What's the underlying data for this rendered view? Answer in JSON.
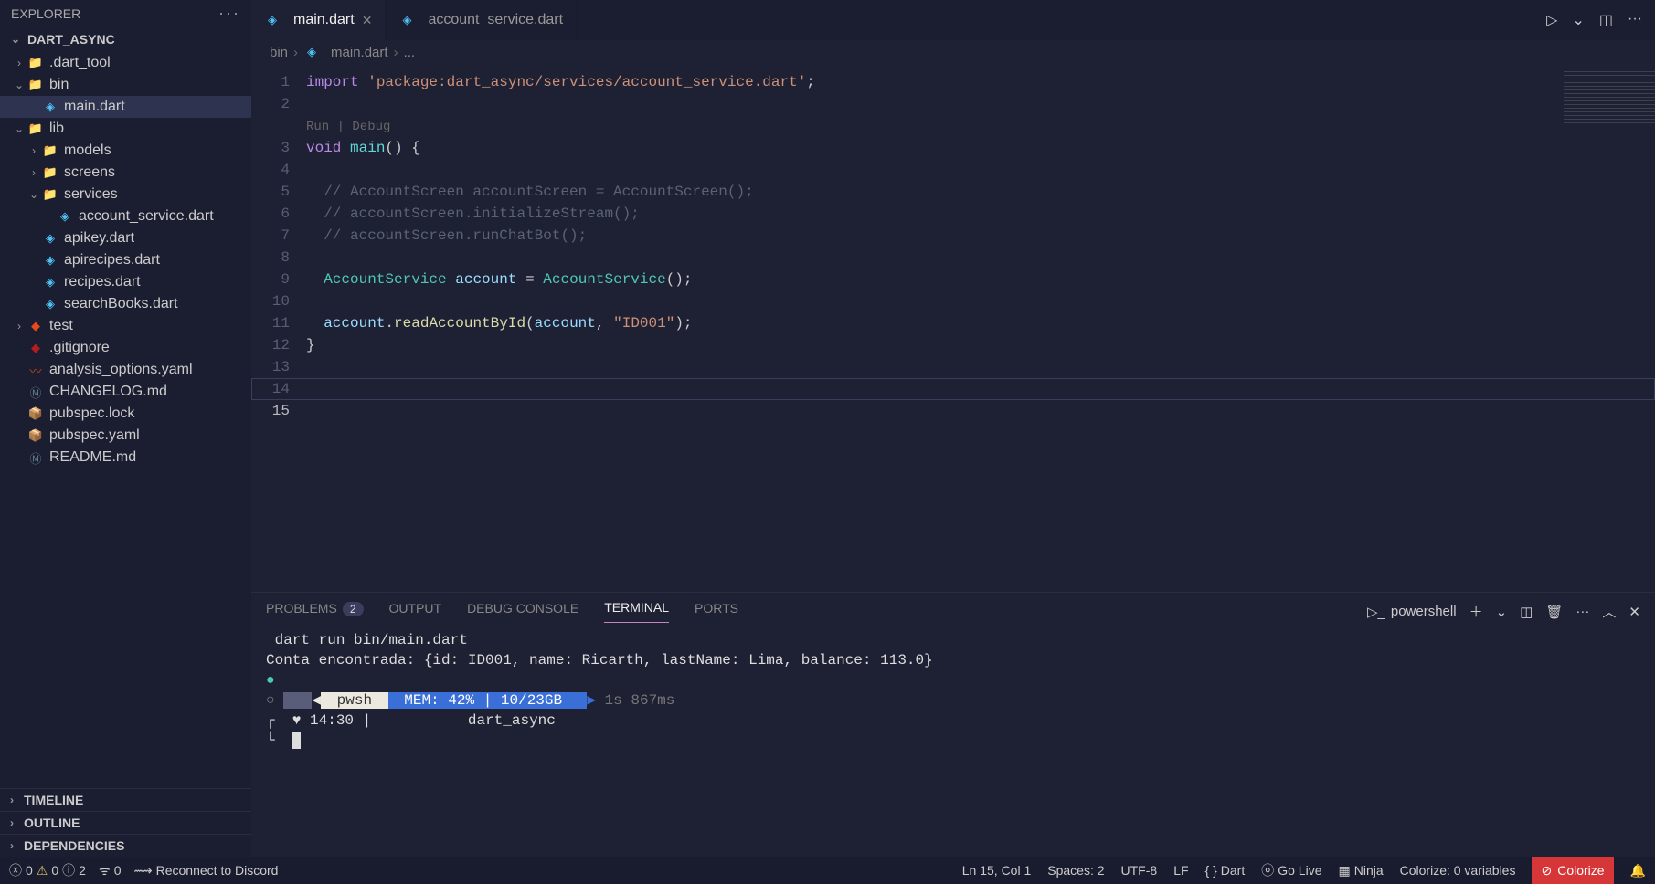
{
  "sidebar": {
    "title": "EXPLORER",
    "project": "DART_ASYNC",
    "tree": [
      {
        "lvl": 1,
        "chev": "›",
        "icon": "folder",
        "name": ".dart_tool"
      },
      {
        "lvl": 1,
        "chev": "⌄",
        "icon": "folder",
        "name": "bin"
      },
      {
        "lvl": 2,
        "chev": "",
        "icon": "dart",
        "name": "main.dart",
        "active": true
      },
      {
        "lvl": 1,
        "chev": "⌄",
        "icon": "folder",
        "name": "lib"
      },
      {
        "lvl": 2,
        "chev": "›",
        "icon": "folder",
        "name": "models"
      },
      {
        "lvl": 2,
        "chev": "›",
        "icon": "folder",
        "name": "screens"
      },
      {
        "lvl": 2,
        "chev": "⌄",
        "icon": "folder",
        "name": "services"
      },
      {
        "lvl": 3,
        "chev": "",
        "icon": "dart",
        "name": "account_service.dart"
      },
      {
        "lvl": 2,
        "chev": "",
        "icon": "dart",
        "name": "apikey.dart"
      },
      {
        "lvl": 2,
        "chev": "",
        "icon": "dart",
        "name": "apirecipes.dart"
      },
      {
        "lvl": 2,
        "chev": "",
        "icon": "dart",
        "name": "recipes.dart"
      },
      {
        "lvl": 2,
        "chev": "",
        "icon": "dart",
        "name": "searchBooks.dart"
      },
      {
        "lvl": 1,
        "chev": "›",
        "icon": "git",
        "name": "test"
      },
      {
        "lvl": 1,
        "chev": "",
        "icon": "ignore",
        "name": ".gitignore"
      },
      {
        "lvl": 1,
        "chev": "",
        "icon": "yaml",
        "name": "analysis_options.yaml"
      },
      {
        "lvl": 1,
        "chev": "",
        "icon": "md",
        "name": "CHANGELOG.md"
      },
      {
        "lvl": 1,
        "chev": "",
        "icon": "pub",
        "name": "pubspec.lock"
      },
      {
        "lvl": 1,
        "chev": "",
        "icon": "pub",
        "name": "pubspec.yaml"
      },
      {
        "lvl": 1,
        "chev": "",
        "icon": "md",
        "name": "README.md"
      }
    ],
    "panels": [
      "TIMELINE",
      "OUTLINE",
      "DEPENDENCIES"
    ]
  },
  "tabs": [
    {
      "name": "main.dart",
      "icon": "dart",
      "active": true,
      "closable": true
    },
    {
      "name": "account_service.dart",
      "icon": "dart",
      "active": false,
      "closable": false
    }
  ],
  "breadcrumb": [
    "bin",
    "main.dart",
    "..."
  ],
  "codelens": "Run | Debug",
  "code_lines": 15,
  "current_line": 15,
  "panel": {
    "tabs": [
      {
        "label": "PROBLEMS",
        "badge": "2"
      },
      {
        "label": "OUTPUT"
      },
      {
        "label": "DEBUG CONSOLE"
      },
      {
        "label": "TERMINAL",
        "active": true
      },
      {
        "label": "PORTS"
      }
    ],
    "shell": "powershell"
  },
  "terminal": {
    "cmd": " dart run bin/main.dart",
    "out": "Conta encontrada: {id: ID001, name: Ricarth, lastName: Lima, balance: 113.0}",
    "pwsh": "pwsh",
    "mem": " MEM: 42% | 10/23GB  ",
    "elapsed": " 1s 867ms",
    "time": "14:30",
    "dir": "dart_async"
  },
  "status": {
    "errors_icon": "ⓧ",
    "errors": "0",
    "warnings_icon": "⚠",
    "warnings": "0",
    "info_icon": "ⓘ",
    "info": "2",
    "radio": "0",
    "discord": "Reconnect to Discord",
    "position": "Ln 15, Col 1",
    "spaces": "Spaces: 2",
    "encoding": "UTF-8",
    "eol": "LF",
    "lang": "Dart",
    "golive": "Go Live",
    "ninja": "Ninja",
    "colorize_vars": "Colorize: 0 variables",
    "colorize_btn": "Colorize"
  }
}
